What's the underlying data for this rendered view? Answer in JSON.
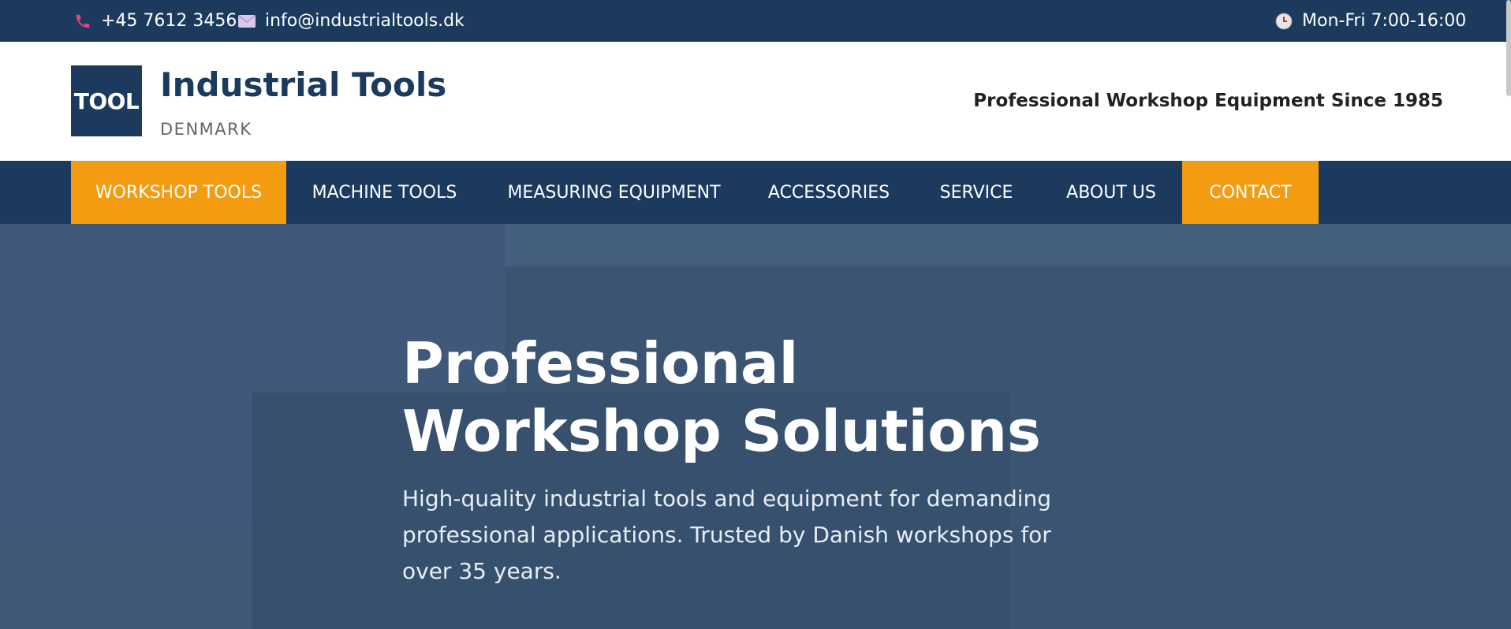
{
  "topbar": {
    "phone": "+45 7612 3456",
    "email": "info@industrialtools.dk",
    "hours": "Mon-Fri 7:00-16:00",
    "icons": {
      "phone": "phone-icon",
      "email": "mail-icon",
      "hours": "clock-icon"
    }
  },
  "header": {
    "logo_text": "TOOL",
    "brand_name": "Industrial Tools",
    "brand_sub": "DENMARK",
    "tagline": "Professional Workshop Equipment Since 1985"
  },
  "nav": {
    "items": [
      {
        "label": "WORKSHOP TOOLS",
        "active": true
      },
      {
        "label": "MACHINE TOOLS",
        "active": false
      },
      {
        "label": "MEASURING EQUIPMENT",
        "active": false
      },
      {
        "label": "ACCESSORIES",
        "active": false
      },
      {
        "label": "SERVICE",
        "active": false
      },
      {
        "label": "ABOUT US",
        "active": false
      },
      {
        "label": "CONTACT",
        "active": true
      }
    ]
  },
  "hero": {
    "title": "Professional Workshop Solutions",
    "text": "High-quality industrial tools and equipment for demanding professional applications. Trusted by Danish workshops for over 35 years."
  },
  "colors": {
    "primary": "#1b3a5e",
    "accent": "#f39c12",
    "hero_bg": "#3d5875"
  }
}
